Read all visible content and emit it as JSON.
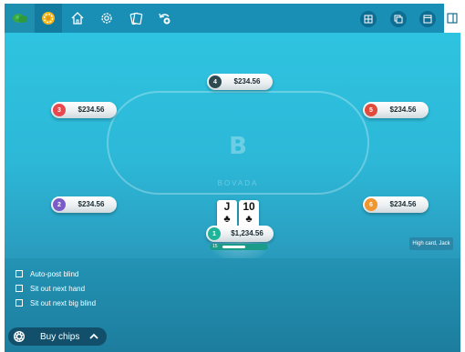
{
  "toolbar": {
    "left_icons": [
      "lobby-icon",
      "chips-icon",
      "home-icon",
      "gear-icon",
      "cards-icon",
      "undo-icon"
    ],
    "right_icons": [
      "grid-icon",
      "tables-icon",
      "window-icon",
      "exit-icon"
    ]
  },
  "table": {
    "logo_letter": "B",
    "logo_text": "BOVADA"
  },
  "seats": [
    {
      "number": "4",
      "stack": "$234.56",
      "color": "#2d4a52"
    },
    {
      "number": "3",
      "stack": "$234.56",
      "color": "#e8494f"
    },
    {
      "number": "5",
      "stack": "$234.56",
      "color": "#e14b3c"
    },
    {
      "number": "2",
      "stack": "$234.56",
      "color": "#7b5bc6"
    },
    {
      "number": "6",
      "stack": "$234.56",
      "color": "#f2952e"
    }
  ],
  "hero": {
    "number": "1",
    "stack": "$1,234.56",
    "color": "#1fb39a",
    "timer_label": "15",
    "timer_fraction": 0.55,
    "cards": [
      {
        "rank": "J",
        "suit": "♣"
      },
      {
        "rank": "10",
        "suit": "♣"
      }
    ]
  },
  "hand_description": "High card, Jack",
  "options": [
    {
      "label": "Auto-post blind",
      "checked": false
    },
    {
      "label": "Sit out next hand",
      "checked": false
    },
    {
      "label": "Sit out next big blind",
      "checked": false
    }
  ],
  "buy_chips": {
    "label": "Buy chips",
    "icon": "chip-icon",
    "chevron": "chevron-up-icon"
  }
}
